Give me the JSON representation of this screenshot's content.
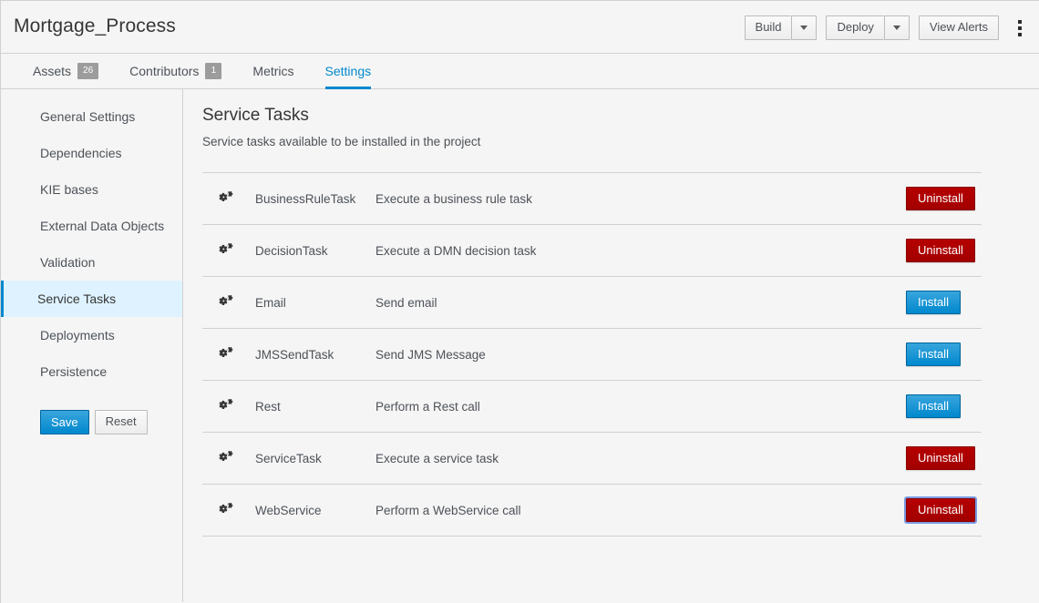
{
  "header": {
    "title": "Mortgage_Process",
    "build_label": "Build",
    "deploy_label": "Deploy",
    "view_alerts_label": "View Alerts",
    "build_caret_icon": "chevron-down-icon",
    "deploy_caret_icon": "chevron-down-icon",
    "kebab_icon": "kebab-vertical-icon"
  },
  "tabs": [
    {
      "label": "Assets",
      "badge": "26",
      "active": false
    },
    {
      "label": "Contributors",
      "badge": "1",
      "active": false
    },
    {
      "label": "Metrics",
      "badge": "",
      "active": false
    },
    {
      "label": "Settings",
      "badge": "",
      "active": true
    }
  ],
  "sidebar": {
    "items": [
      {
        "label": "General Settings",
        "active": false
      },
      {
        "label": "Dependencies",
        "active": false
      },
      {
        "label": "KIE bases",
        "active": false
      },
      {
        "label": "External Data Objects",
        "active": false
      },
      {
        "label": "Validation",
        "active": false
      },
      {
        "label": "Service Tasks",
        "active": true
      },
      {
        "label": "Deployments",
        "active": false
      },
      {
        "label": "Persistence",
        "active": false
      }
    ],
    "save_label": "Save",
    "reset_label": "Reset"
  },
  "main": {
    "title": "Service Tasks",
    "subtitle": "Service tasks available to be installed in the project",
    "rows": [
      {
        "icon": "cogs-icon",
        "name": "BusinessRuleTask",
        "description": "Execute a business rule task",
        "action": "Uninstall",
        "state": "installed",
        "focused": false
      },
      {
        "icon": "cogs-icon",
        "name": "DecisionTask",
        "description": "Execute a DMN decision task",
        "action": "Uninstall",
        "state": "installed",
        "focused": false
      },
      {
        "icon": "cogs-icon",
        "name": "Email",
        "description": "Send email",
        "action": "Install",
        "state": "notinstalled",
        "focused": false
      },
      {
        "icon": "cogs-icon",
        "name": "JMSSendTask",
        "description": "Send JMS Message",
        "action": "Install",
        "state": "notinstalled",
        "focused": false
      },
      {
        "icon": "cogs-icon",
        "name": "Rest",
        "description": "Perform a Rest call",
        "action": "Install",
        "state": "notinstalled",
        "focused": false
      },
      {
        "icon": "cogs-icon",
        "name": "ServiceTask",
        "description": "Execute a service task",
        "action": "Uninstall",
        "state": "installed",
        "focused": false
      },
      {
        "icon": "cogs-icon",
        "name": "WebService",
        "description": "Perform a WebService call",
        "action": "Uninstall",
        "state": "installed",
        "focused": true
      }
    ]
  },
  "colors": {
    "accent_blue": "#0088ce",
    "uninstall_red": "#a30000",
    "badge_gray": "#9c9c9c",
    "active_item_bg": "#def3ff",
    "page_bg": "#f5f5f5",
    "border": "#d1d1d1",
    "focus_ring": "#7a9ae0"
  }
}
